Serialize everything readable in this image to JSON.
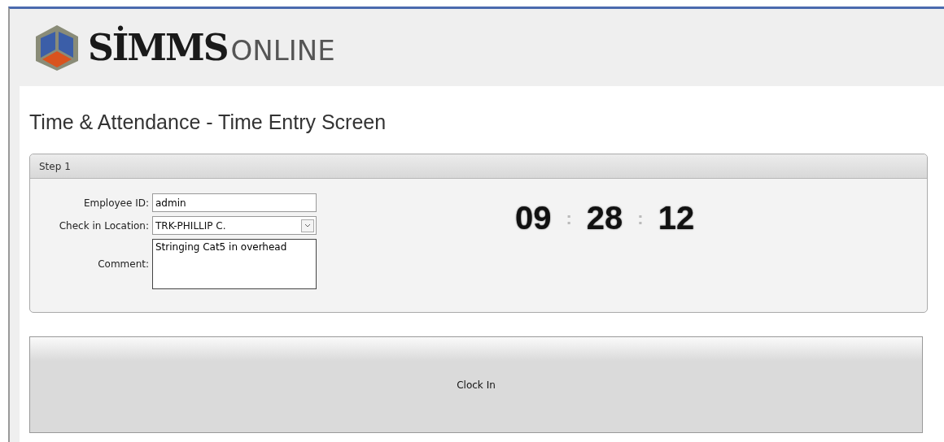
{
  "logo": {
    "brand": "SİMMS",
    "suffix": "ONLINE"
  },
  "page_title": "Time & Attendance - Time Entry Screen",
  "step": {
    "title": "Step 1",
    "fields": [
      {
        "kind": "text",
        "label": "Employee ID:",
        "value": "admin"
      },
      {
        "kind": "select",
        "label": "Check in Location:",
        "value": "TRK-PHILLIP C."
      },
      {
        "kind": "textarea",
        "label": "Comment:",
        "value": "Stringing Cat5 in overhead"
      }
    ],
    "clock": {
      "hours": "09",
      "separator_1": ":",
      "minutes": "28",
      "separator_2": ":",
      "seconds": "12"
    }
  },
  "clock_in_button": "Clock In"
}
